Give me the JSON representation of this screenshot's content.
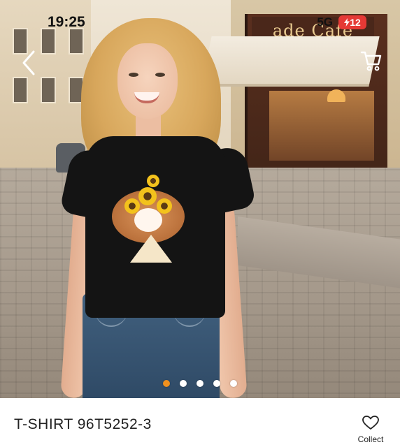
{
  "status_bar": {
    "time": "19:25",
    "network": "5G",
    "battery": "12"
  },
  "gallery": {
    "total_images": 5,
    "active_index": 0,
    "accent_color": "#f0901e"
  },
  "background": {
    "cafe_sign": "ade Café"
  },
  "product": {
    "title": "T-SHIRT 96T5252-3"
  },
  "actions": {
    "collect_label": "Collect"
  },
  "icons": {
    "back": "chevron-left-icon",
    "cart": "shopping-cart-icon",
    "collect": "heart-icon",
    "battery_charging": "bolt-icon"
  }
}
